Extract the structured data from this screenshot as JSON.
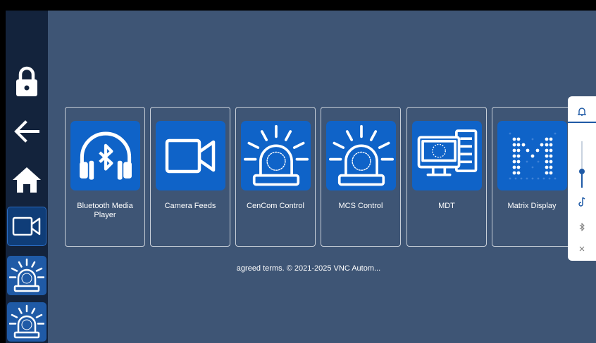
{
  "sidebar": {
    "items": [
      {
        "icon": "lock-icon"
      },
      {
        "icon": "back-arrow-icon"
      },
      {
        "icon": "home-icon"
      },
      {
        "icon": "camera-icon"
      },
      {
        "icon": "beacon-icon"
      },
      {
        "icon": "beacon-icon"
      }
    ]
  },
  "cards": [
    {
      "label": "Bluetooth Media Player",
      "icon": "bluetooth-headphones-icon"
    },
    {
      "label": "Camera Feeds",
      "icon": "video-camera-icon"
    },
    {
      "label": "CenCom Control",
      "icon": "beacon-icon"
    },
    {
      "label": "MCS Control",
      "icon": "beacon-icon"
    },
    {
      "label": "MDT",
      "icon": "computer-icon"
    },
    {
      "label": "Matrix Display",
      "icon": "matrix-m-icon"
    }
  ],
  "footer": {
    "text": "agreed terms. © 2021-2025 VNC Autom..."
  },
  "quick_panel": {
    "items": [
      "bell-icon",
      "volume-slider",
      "music-note-icon",
      "bluetooth-icon",
      "close-icon"
    ],
    "volume_level": 0.35
  },
  "colors": {
    "background": "#3e5575",
    "sidebar": "#13233c",
    "tile": "#0f63c8",
    "accent": "#1f5aa6"
  }
}
